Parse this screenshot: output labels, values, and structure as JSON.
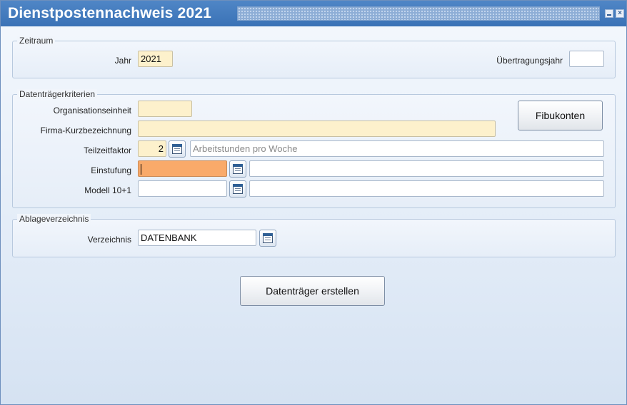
{
  "window": {
    "title": "Dienstpostennachweis 2021",
    "minimize_glyph": "",
    "close_glyph": "×"
  },
  "zeitraum": {
    "legend": "Zeitraum",
    "jahr_label": "Jahr",
    "jahr_value": "2021",
    "uebertragungsjahr_label": "Übertragungsjahr",
    "uebertragungsjahr_value": ""
  },
  "kriterien": {
    "legend": "Datenträgerkriterien",
    "organisationseinheit_label": "Organisationseinheit",
    "organisationseinheit_value": "",
    "firma_label": "Firma-Kurzbezeichnung",
    "firma_value": "",
    "teilzeitfaktor_label": "Teilzeitfaktor",
    "teilzeitfaktor_value": "2",
    "teilzeitfaktor_desc": "Arbeitstunden pro Woche",
    "einstufung_label": "Einstufung",
    "einstufung_value": "",
    "einstufung_desc": "",
    "modell_label": "Modell 10+1",
    "modell_value": "",
    "modell_desc": "",
    "fibukonten_button": "Fibukonten"
  },
  "ablage": {
    "legend": "Ablageverzeichnis",
    "verzeichnis_label": "Verzeichnis",
    "verzeichnis_value": "DATENBANK"
  },
  "actions": {
    "create_button": "Datenträger erstellen"
  },
  "colors": {
    "titlebar": "#3a72b6",
    "required_field": "#fdf1cc",
    "focused_field": "#f9aa6a"
  },
  "icons": {
    "picker": "calendar-list-icon"
  }
}
